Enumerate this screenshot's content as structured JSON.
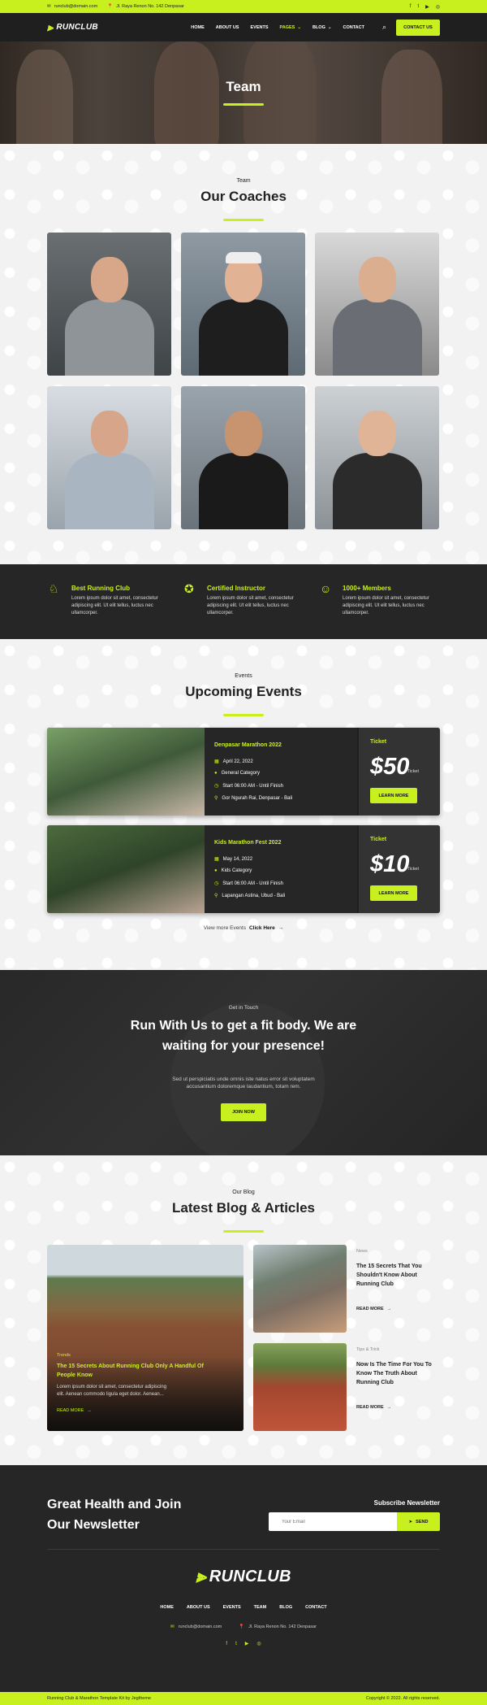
{
  "topbar": {
    "email": "runclub@domain.com",
    "address": "Jl. Raya Renon No. 142 Denpasar",
    "social": [
      "f",
      "t",
      "▶",
      "◎"
    ]
  },
  "nav": {
    "logo": "RUNCLUB",
    "items": [
      "HOME",
      "ABOUT US",
      "EVENTS",
      "PAGES",
      "BLOG",
      "CONTACT"
    ],
    "active_index": 3,
    "cta": "CONTACT US"
  },
  "hero": {
    "title": "Team"
  },
  "coaches": {
    "eyebrow": "Team",
    "title": "Our Coaches"
  },
  "features": [
    {
      "title": "Best Running Club",
      "icon": "medal-icon",
      "text": "Lorem ipsum dolor sit amet, consectetur adipiscing elit. Ut elit tellus, luctus nec ullamcorper."
    },
    {
      "title": "Certified Instructor",
      "icon": "certificate-icon",
      "text": "Lorem ipsum dolor sit amet, consectetur adipiscing elit. Ut elit tellus, luctus nec ullamcorper."
    },
    {
      "title": "1000+ Members",
      "icon": "group-icon",
      "text": "Lorem ipsum dolor sit amet, consectetur adipiscing elit. Ut elit tellus, luctus nec ullamcorper."
    }
  ],
  "events": {
    "eyebrow": "Events",
    "title": "Upcoming Events",
    "items": [
      {
        "name": "Denpasar Marathon 2022",
        "date": "April 22, 2022",
        "category": "General Category",
        "time": "Start 06:00 AM - Until Finish",
        "location": "Gor Ngurah Rai, Denpasar - Bali",
        "ticket_label": "Ticket",
        "price": "$50",
        "per": "/Ticket",
        "button": "LEARN MORE"
      },
      {
        "name": "Kids Marathon Fest 2022",
        "date": "May 14, 2022",
        "category": "Kids Category",
        "time": "Start 06:00 AM - Until Finish",
        "location": "Lapangan Astina, Ubud - Bali",
        "ticket_label": "Ticket",
        "price": "$10",
        "per": "/Ticket",
        "button": "LEARN MORE"
      }
    ],
    "more_prefix": "View more Events",
    "more_link": "Click Here"
  },
  "cta": {
    "eyebrow": "Get in Touch",
    "title_line1": "Run With Us to get a fit body. We are",
    "title_line2": "waiting for your presence!",
    "text_line1": "Sed ut perspiciatis unde omnis iste natus error sit voluptatem",
    "text_line2": "accusantium doloremque laudantium, totam rem.",
    "button": "JOIN NOW"
  },
  "blog": {
    "eyebrow": "Our Blog",
    "title": "Latest Blog & Articles",
    "featured": {
      "tag": "Trends",
      "title_line1": "The 15 Secrets About Running Club Only A Handful Of",
      "title_line2": "People Know",
      "text_line1": "Lorem ipsum dolor sit amet, consectetur adipiscing",
      "text_line2": "elit. Aenean commodo ligula eget dolor. Aenean...",
      "link": "READ MORE"
    },
    "posts": [
      {
        "tag": "News",
        "title_line1": "The 15 Secrets That You",
        "title_line2": "Shouldn't Know About",
        "title_line3": "Running Club",
        "link": "READ MORE"
      },
      {
        "tag": "Tips & Trick",
        "title_line1": "Now Is The Time For You To",
        "title_line2": "Know The Truth About",
        "title_line3": "Running Club",
        "link": "READ MORE"
      }
    ]
  },
  "footer": {
    "newsletter_line1": "Great Health and Join",
    "newsletter_line2": "Our Newsletter",
    "subscribe_label": "Subscribe Newsletter",
    "email_placeholder": "Your Email",
    "send": "SEND",
    "logo": "RUNCLUB",
    "links": [
      "HOME",
      "ABOUT US",
      "EVENTS",
      "TEAM",
      "BLOG",
      "CONTACT"
    ],
    "email": "runclub@domain.com",
    "address": "Jl. Raya Renon No. 142 Denpasar",
    "social": [
      "f",
      "t",
      "▶",
      "◎"
    ]
  },
  "bottombar": {
    "left": "Running Club & Marathon Template Kit by Jegtheme",
    "right": "Copyright © 2022. All rights reserved."
  },
  "colors": {
    "accent": "#c8f01e",
    "dark": "#262626"
  }
}
